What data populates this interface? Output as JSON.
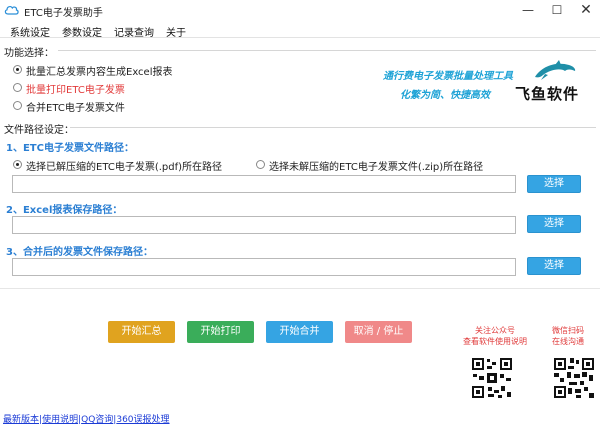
{
  "window": {
    "title": "ETC电子发票助手",
    "min": "—",
    "max": "☐",
    "close": "✕"
  },
  "menu": [
    "系统设定",
    "参数设定",
    "记录查询",
    "关于"
  ],
  "function_section": {
    "label": "功能选择：",
    "options": [
      {
        "label": "批量汇总发票内容生成Excel报表",
        "checked": true
      },
      {
        "label": "批量打印ETC电子发票",
        "checked": false
      },
      {
        "label": "合并ETC电子发票文件",
        "checked": false
      }
    ]
  },
  "brand": {
    "slogan1": "通行费电子发票批量处理工具",
    "slogan2": "化繁为简、快捷高效",
    "name": "飞鱼软件",
    "color": "#1f8fa8"
  },
  "path_section": {
    "label": "文件路径设定：",
    "invoice_path": {
      "heading": "1、ETC电子发票文件路径：",
      "opt_unzipped": "选择已解压缩的ETC电子发票(.pdf)所在路径",
      "opt_zip": "选择未解压缩的ETC电子发票文件(.zip)所在路径",
      "value": "",
      "button": "选择"
    },
    "excel_path": {
      "heading": "2、Excel报表保存路径：",
      "value": "",
      "button": "选择"
    },
    "merge_path": {
      "heading": "3、合并后的发票文件保存路径：",
      "value": "",
      "button": "选择"
    }
  },
  "actions": [
    {
      "label": "开始汇总",
      "color": "#e0a31f"
    },
    {
      "label": "开始打印",
      "color": "#3aad5a"
    },
    {
      "label": "开始合并",
      "color": "#35a4e3"
    },
    {
      "label": "取消 / 停止",
      "color": "#f08989"
    }
  ],
  "qr": {
    "left_caption1": "关注公众号",
    "left_caption2": "查看软件使用说明",
    "right_caption1": "微信扫码",
    "right_caption2": "在线沟通"
  },
  "footer": [
    "最新版本",
    "使用说明",
    "QQ咨询",
    "360误报处理"
  ]
}
